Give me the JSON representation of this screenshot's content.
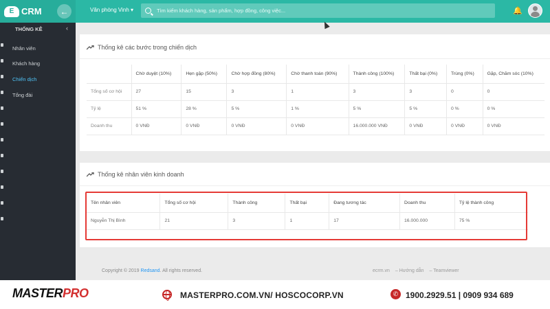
{
  "header": {
    "logo_text": "CRM",
    "logo_badge": "E",
    "back_icon": "arrow-left-icon",
    "office": "Văn phòng Vinh",
    "search_placeholder": "Tìm kiếm khách hàng, sản phẩm, hợp đồng, công việc...",
    "bell_icon": "bell-icon"
  },
  "sidebar": {
    "title": "THỐNG KÊ",
    "items": [
      {
        "label": "Nhân viên"
      },
      {
        "label": "Khách hàng"
      },
      {
        "label": "Chiến dịch",
        "active": true
      },
      {
        "label": "Tổng đài"
      }
    ]
  },
  "campaign_card": {
    "title": "Thống kê các bước trong chiến dịch",
    "columns": [
      "",
      "Chờ duyệt (10%)",
      "Hẹn gặp (50%)",
      "Chờ hợp đồng (80%)",
      "Chờ thanh toán (90%)",
      "Thành công (100%)",
      "Thất bại (0%)",
      "Trùng (0%)",
      "Gặp, Chăm sóc (10%)"
    ],
    "rows": [
      [
        "Tổng số cơ hội",
        "27",
        "15",
        "3",
        "1",
        "3",
        "3",
        "0",
        "0"
      ],
      [
        "Tỷ lệ",
        "51 %",
        "28 %",
        "5 %",
        "1 %",
        "5 %",
        "5 %",
        "0 %",
        "0 %"
      ],
      [
        "Doanh thu",
        "0 VNĐ",
        "0 VNĐ",
        "0 VNĐ",
        "0 VNĐ",
        "16.000.000 VNĐ",
        "0 VNĐ",
        "0 VNĐ",
        "0 VNĐ"
      ]
    ]
  },
  "staff_card": {
    "title": "Thống kê nhân viên kinh doanh",
    "columns": [
      "Tên nhân viên",
      "Tổng số cơ hội",
      "Thành công",
      "Thất bại",
      "Đang tương tác",
      "Doanh thu",
      "Tỷ lệ thành công"
    ],
    "rows": [
      [
        "Nguyễn Thị Bình",
        "21",
        "3",
        "1",
        "17",
        "16.000.000",
        "75 %"
      ]
    ]
  },
  "footer": {
    "copyright_prefix": "Copyright © 2019",
    "brand": "Redsand",
    "copyright_suffix": ". All rights reserved.",
    "links": [
      "ecrm.vn",
      "Hướng dẫn",
      "Teamviewer"
    ]
  },
  "banner": {
    "logo_main": "MASTER",
    "logo_accent": "PRO",
    "website": "MASTERPRO.COM.VN/ HOSCOCORP.VN",
    "phones": "1900.2929.51 | 0909 934 689",
    "accent_color": "#c62828"
  },
  "colors": {
    "header_teal": "#2bb8a5",
    "sidebar_dark": "#272c33",
    "active_link": "#4fc3f7",
    "highlight_red": "#e53935"
  }
}
